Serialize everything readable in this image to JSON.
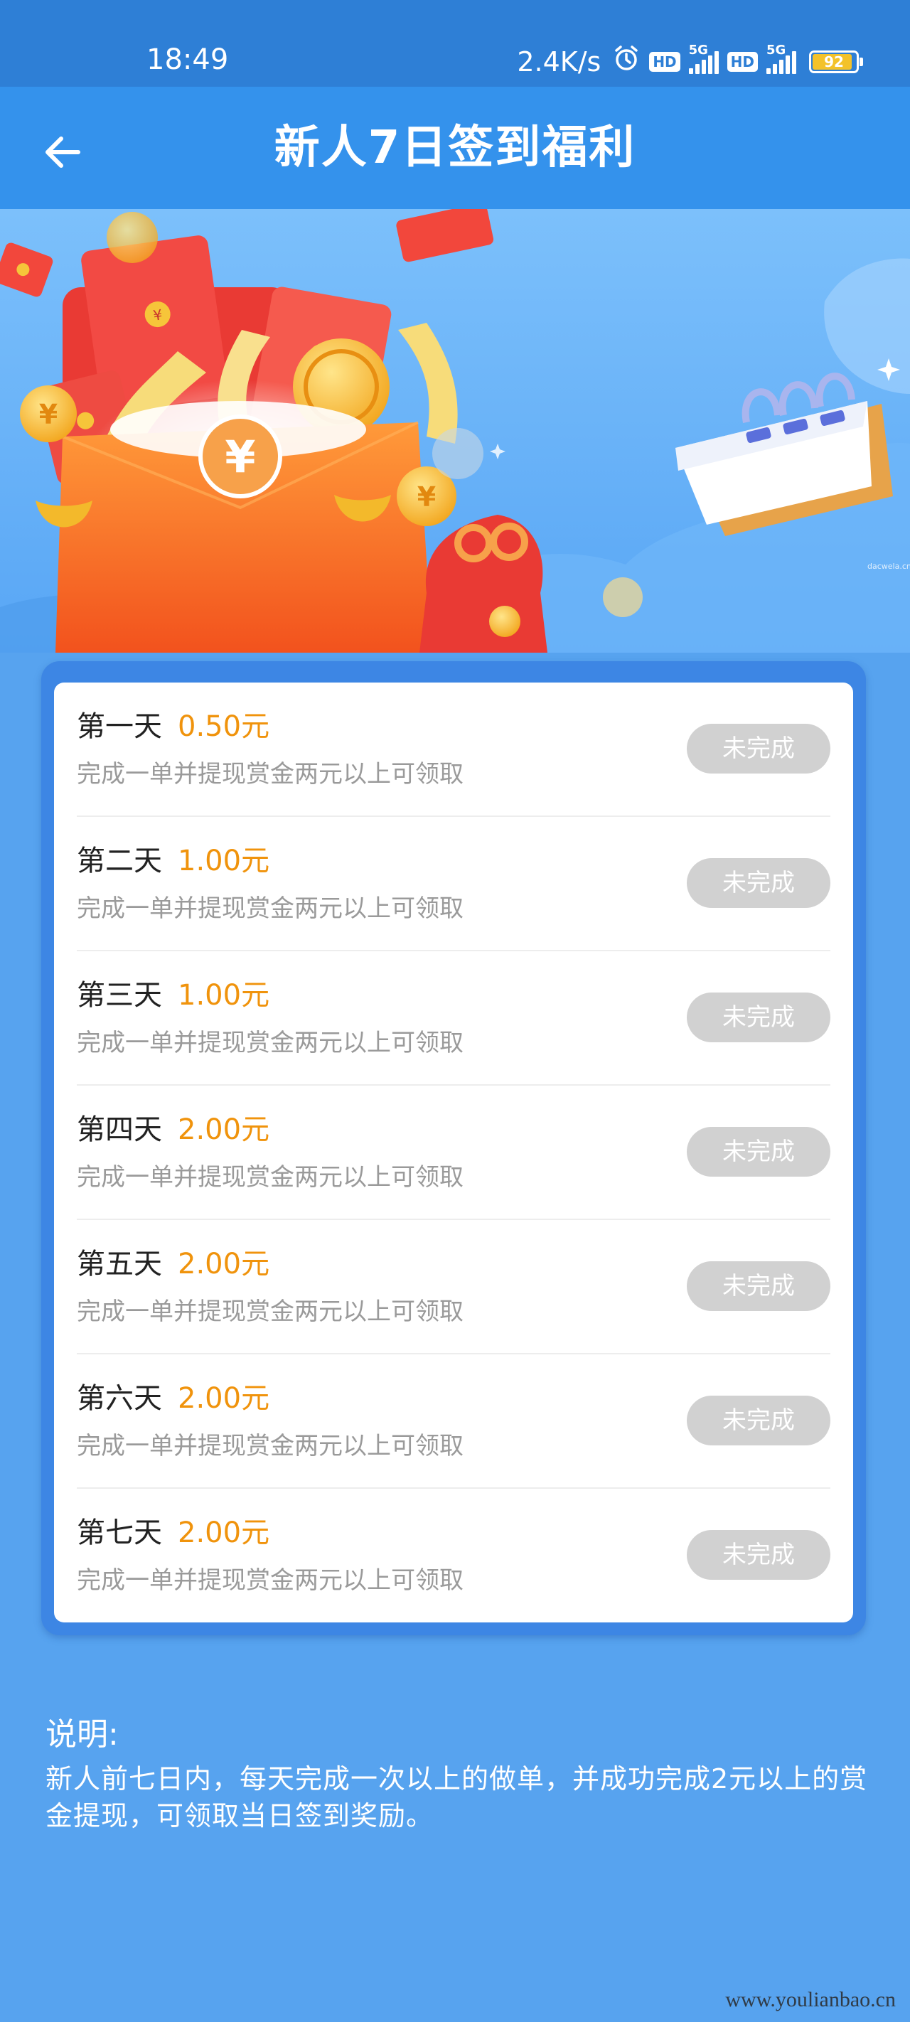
{
  "status_bar": {
    "time": "18:49",
    "net_speed": "2.4K/s",
    "hd1": "HD",
    "fiveg1": "5G",
    "hd2": "HD",
    "fiveg2": "5G",
    "battery": "92",
    "battery_color": "#f3c22a"
  },
  "header": {
    "back_icon": "arrow-left-icon",
    "title": "新人7日签到福利"
  },
  "banner": {
    "coin_symbol": "¥",
    "corner_text": "dacwela.cn"
  },
  "tasks": [
    {
      "day": "第一天",
      "amount": "0.50元",
      "desc": "完成一单并提现赏金两元以上可领取",
      "status": "未完成"
    },
    {
      "day": "第二天",
      "amount": "1.00元",
      "desc": "完成一单并提现赏金两元以上可领取",
      "status": "未完成"
    },
    {
      "day": "第三天",
      "amount": "1.00元",
      "desc": "完成一单并提现赏金两元以上可领取",
      "status": "未完成"
    },
    {
      "day": "第四天",
      "amount": "2.00元",
      "desc": "完成一单并提现赏金两元以上可领取",
      "status": "未完成"
    },
    {
      "day": "第五天",
      "amount": "2.00元",
      "desc": "完成一单并提现赏金两元以上可领取",
      "status": "未完成"
    },
    {
      "day": "第六天",
      "amount": "2.00元",
      "desc": "完成一单并提现赏金两元以上可领取",
      "status": "未完成"
    },
    {
      "day": "第七天",
      "amount": "2.00元",
      "desc": "完成一单并提现赏金两元以上可领取",
      "status": "未完成"
    }
  ],
  "notes": {
    "title": "说明:",
    "text": "新人前七日内，每天完成一次以上的做单，并成功完成2元以上的赏金提现，可领取当日签到奖励。"
  },
  "watermark": "www.youlianbao.cn",
  "colors": {
    "page_bg": "#57a3ef",
    "header_bg": "#3492ec",
    "status_bar_bg": "#2e7fd6",
    "amount": "#f0930c",
    "button_disabled": "#d1d1d1"
  }
}
